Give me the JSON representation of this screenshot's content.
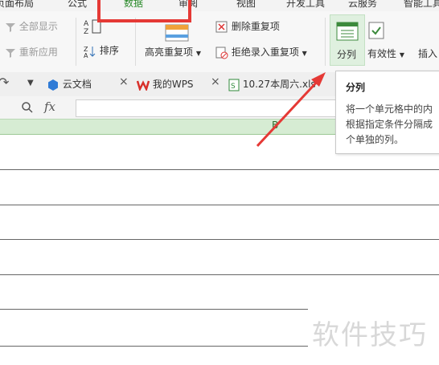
{
  "menu": {
    "tabs": [
      {
        "label": "页面布局"
      },
      {
        "label": "公式"
      },
      {
        "label": "数据",
        "active": true
      },
      {
        "label": "审阅"
      },
      {
        "label": "视图"
      },
      {
        "label": "开发工具"
      },
      {
        "label": "云服务"
      },
      {
        "label": "智能工具"
      }
    ]
  },
  "ribbon": {
    "show_all": "全部显示",
    "reapply": "重新应用",
    "sort": "排序",
    "highlight_dup": "高亮重复项",
    "remove_dup": "删除重复项",
    "reject_dup": "拒绝录入重复项",
    "split": "分列",
    "validity": "有效性",
    "insert": "插入"
  },
  "doc_tabs": [
    {
      "label": "云文档"
    },
    {
      "label": "我的WPS"
    },
    {
      "label": "10.27本周六.xls"
    }
  ],
  "formula_bar": {
    "fx": "fx",
    "value": ""
  },
  "sheet": {
    "column_label": "B"
  },
  "tooltip": {
    "title": "分列",
    "lines": [
      "将一个单元格中的内",
      "根据指定条件分隔成",
      "个单独的列。"
    ]
  },
  "watermark": "软件技巧",
  "colors": {
    "accent": "#2b8a2b",
    "highlight_box": "#e53935",
    "arrow": "#e53935"
  }
}
